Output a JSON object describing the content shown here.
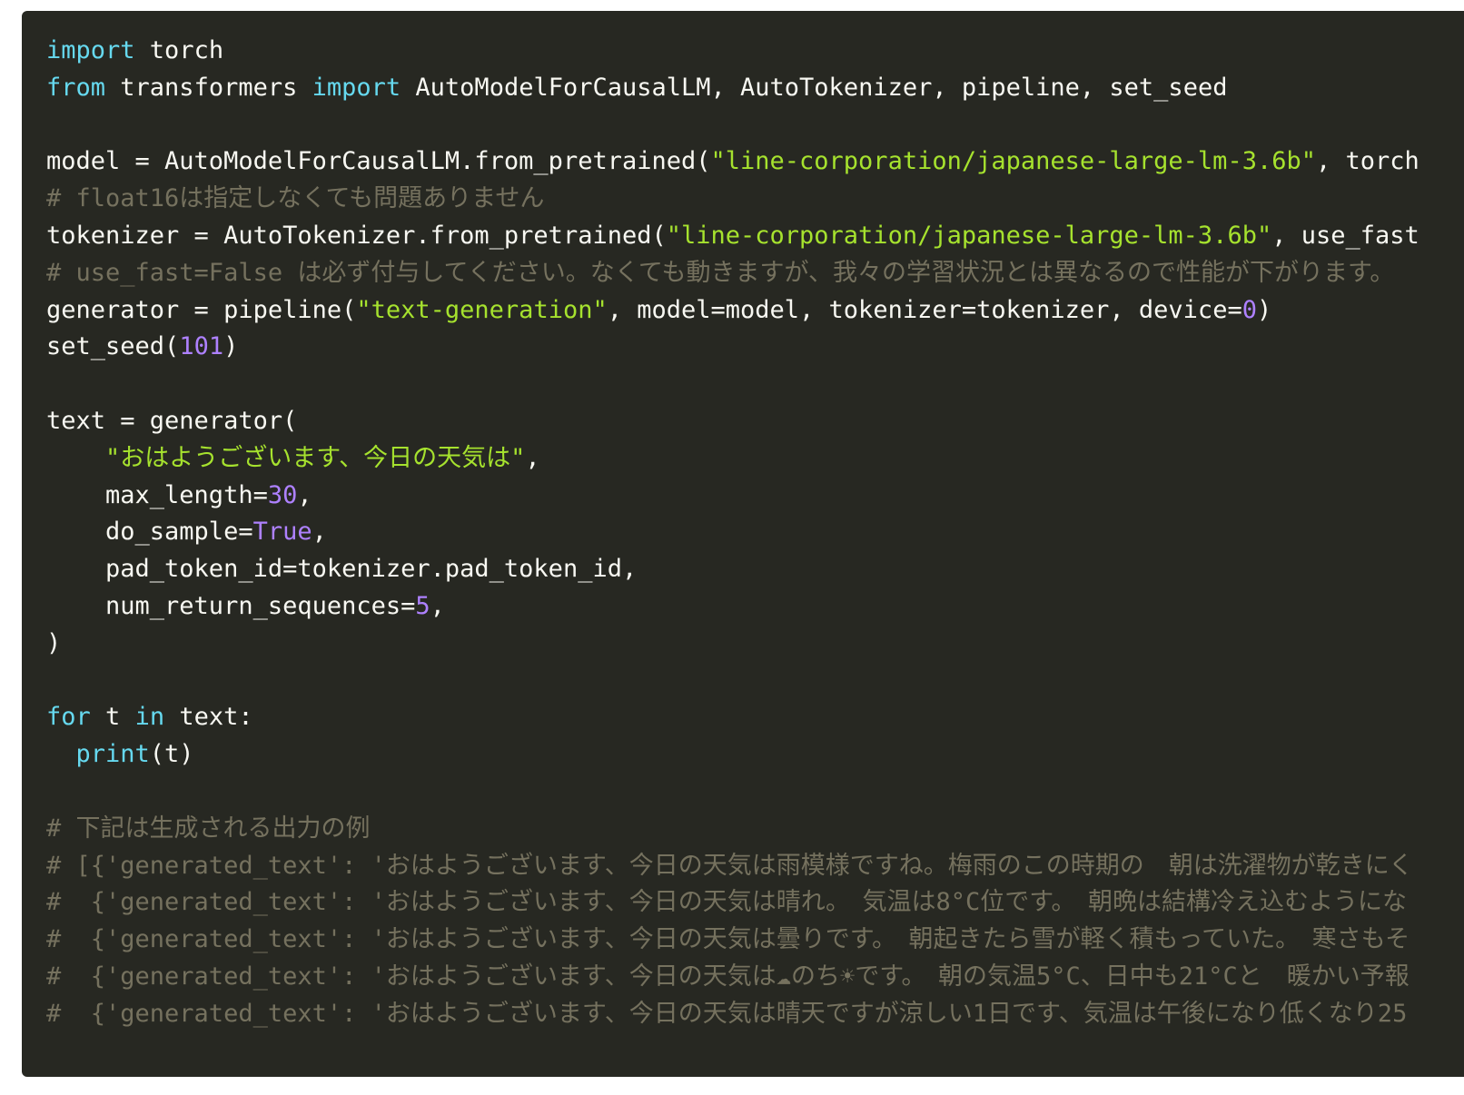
{
  "theme": {
    "background": "#272822",
    "page_background": "#ffffff",
    "colors": {
      "plain": "#f8f8f2",
      "keyword": "#66d9ef",
      "string": "#a6e22e",
      "number": "#ae81ff",
      "comment": "#75715e",
      "builtin": "#66d9ef"
    }
  },
  "code": {
    "language": "python",
    "lines": [
      [
        {
          "t": "kw",
          "v": "import"
        },
        {
          "t": "plain",
          "v": " torch"
        }
      ],
      [
        {
          "t": "kw",
          "v": "from"
        },
        {
          "t": "plain",
          "v": " transformers "
        },
        {
          "t": "kw",
          "v": "import"
        },
        {
          "t": "plain",
          "v": " AutoModelForCausalLM, AutoTokenizer, pipeline, set_seed"
        }
      ],
      [],
      [
        {
          "t": "plain",
          "v": "model = AutoModelForCausalLM.from_pretrained("
        },
        {
          "t": "str",
          "v": "\"line-corporation/japanese-large-lm-3.6b\""
        },
        {
          "t": "plain",
          "v": ", torch"
        }
      ],
      [
        {
          "t": "cm",
          "v": "# float16は指定しなくても問題ありません"
        }
      ],
      [
        {
          "t": "plain",
          "v": "tokenizer = AutoTokenizer.from_pretrained("
        },
        {
          "t": "str",
          "v": "\"line-corporation/japanese-large-lm-3.6b\""
        },
        {
          "t": "plain",
          "v": ", use_fast"
        }
      ],
      [
        {
          "t": "cm",
          "v": "# use_fast=False は必ず付与してください。なくても動きますが、我々の学習状況とは異なるので性能が下がります。"
        }
      ],
      [
        {
          "t": "plain",
          "v": "generator = pipeline("
        },
        {
          "t": "str",
          "v": "\"text-generation\""
        },
        {
          "t": "plain",
          "v": ", model=model, tokenizer=tokenizer, device="
        },
        {
          "t": "num",
          "v": "0"
        },
        {
          "t": "plain",
          "v": ")"
        }
      ],
      [
        {
          "t": "plain",
          "v": "set_seed("
        },
        {
          "t": "num",
          "v": "101"
        },
        {
          "t": "plain",
          "v": ")"
        }
      ],
      [],
      [
        {
          "t": "plain",
          "v": "text = generator("
        }
      ],
      [
        {
          "t": "plain",
          "v": "    "
        },
        {
          "t": "str",
          "v": "\"おはようございます、今日の天気は\""
        },
        {
          "t": "plain",
          "v": ","
        }
      ],
      [
        {
          "t": "plain",
          "v": "    max_length="
        },
        {
          "t": "num",
          "v": "30"
        },
        {
          "t": "plain",
          "v": ","
        }
      ],
      [
        {
          "t": "plain",
          "v": "    do_sample="
        },
        {
          "t": "num",
          "v": "True"
        },
        {
          "t": "plain",
          "v": ","
        }
      ],
      [
        {
          "t": "plain",
          "v": "    pad_token_id=tokenizer.pad_token_id,"
        }
      ],
      [
        {
          "t": "plain",
          "v": "    num_return_sequences="
        },
        {
          "t": "num",
          "v": "5"
        },
        {
          "t": "plain",
          "v": ","
        }
      ],
      [
        {
          "t": "plain",
          "v": ")"
        }
      ],
      [],
      [
        {
          "t": "kw",
          "v": "for"
        },
        {
          "t": "plain",
          "v": " t "
        },
        {
          "t": "kw",
          "v": "in"
        },
        {
          "t": "plain",
          "v": " text:"
        }
      ],
      [
        {
          "t": "plain",
          "v": "  "
        },
        {
          "t": "bi",
          "v": "print"
        },
        {
          "t": "plain",
          "v": "(t)"
        }
      ],
      [],
      [
        {
          "t": "cm",
          "v": "# 下記は生成される出力の例"
        }
      ],
      [
        {
          "t": "cm",
          "v": "# [{'generated_text': 'おはようございます、今日の天気は雨模様ですね。梅雨のこの時期の　朝は洗濯物が乾きにく"
        }
      ],
      [
        {
          "t": "cm",
          "v": "#  {'generated_text': 'おはようございます、今日の天気は晴れ。　気温は8°C位です。　朝晩は結構冷え込むようにな"
        }
      ],
      [
        {
          "t": "cm",
          "v": "#  {'generated_text': 'おはようございます、今日の天気は曇りです。　朝起きたら雪が軽く積もっていた。　寒さもそ"
        }
      ],
      [
        {
          "t": "cm",
          "v": "#  {'generated_text': 'おはようございます、今日の天気は☁のち☀です。　朝の気温5°C、日中も21°Cと　暖かい予報"
        }
      ],
      [
        {
          "t": "cm",
          "v": "#  {'generated_text': 'おはようございます、今日の天気は晴天ですが涼しい1日です、気温は午後になり低くなり25"
        }
      ]
    ]
  }
}
